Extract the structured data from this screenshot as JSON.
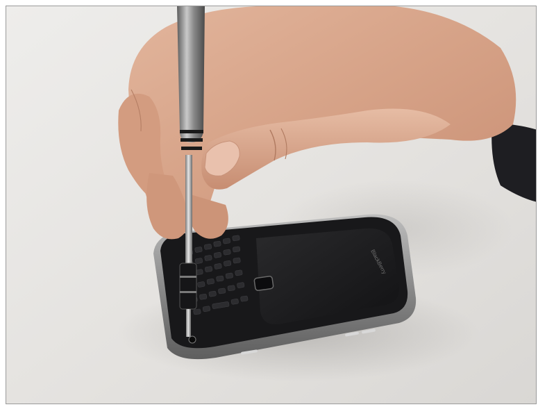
{
  "photo": {
    "subject": "hand-holding-screwdriver-over-phone",
    "colors": {
      "surface": "#e6e4e2",
      "skin": "#d9a98e",
      "phone_body": "#1c1c1e",
      "phone_bezel": "#9c9c9c",
      "screwdriver": "#8f8f8f",
      "sleeve": "#1e1e22"
    }
  },
  "phone": {
    "brand_text": "BlackBerry"
  }
}
